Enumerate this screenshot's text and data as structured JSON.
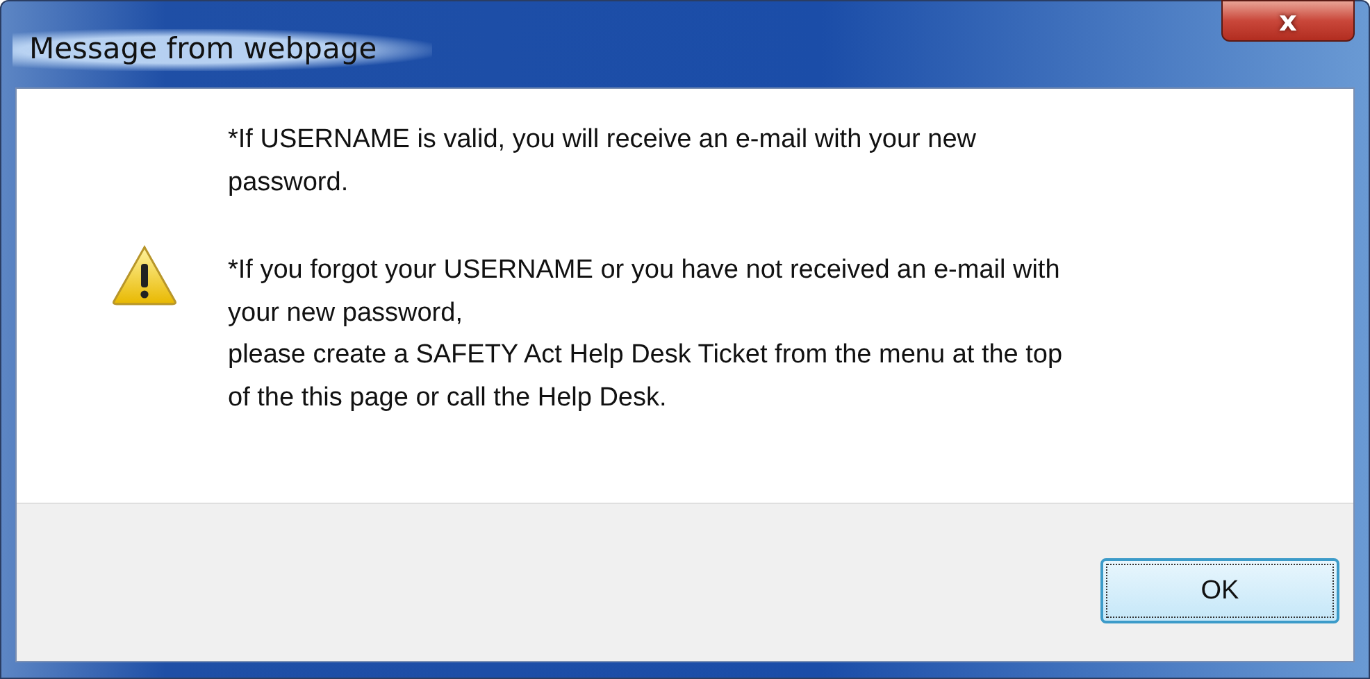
{
  "window": {
    "title": "Message from webpage",
    "close_label": "x"
  },
  "message": {
    "paragraphs": [
      {
        "lines": [
          "*If USERNAME is valid, you will receive an e-mail with your new",
          "password."
        ]
      },
      {
        "lines": [
          "*If you forgot your USERNAME or you have not received an e-mail with",
          "your new password,",
          "please create a SAFETY Act Help Desk Ticket from the menu at the top",
          "of the this page or call the Help Desk."
        ]
      }
    ]
  },
  "buttons": [
    {
      "label": "OK",
      "focused": true
    }
  ]
}
